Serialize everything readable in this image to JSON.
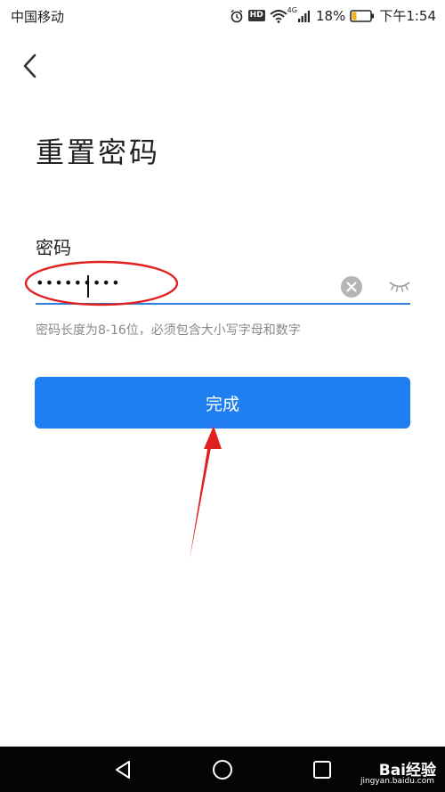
{
  "status_bar": {
    "carrier": "中国移动",
    "network": "4G",
    "battery": "18%",
    "time": "下午1:54",
    "icons": [
      "alarm-icon",
      "hd-icon",
      "wifi-icon",
      "signal-icon",
      "battery-icon"
    ],
    "hd_label": "HD"
  },
  "header": {
    "back_icon": "chevron-left-icon"
  },
  "page": {
    "title": "重置密码",
    "field_label": "密码",
    "password_value": "•••••••••",
    "hint": "密码长度为8-16位，必须包含大小写字母和数字",
    "submit_label": "完成",
    "accent_color": "#1f7ff0",
    "annotation_color": "#e02020"
  },
  "nav_bar": {
    "icons": [
      "triangle-back-icon",
      "circle-home-icon",
      "square-recents-icon"
    ],
    "watermark": "Bai经验",
    "watermark_url": "jingyan.baidu.com"
  }
}
